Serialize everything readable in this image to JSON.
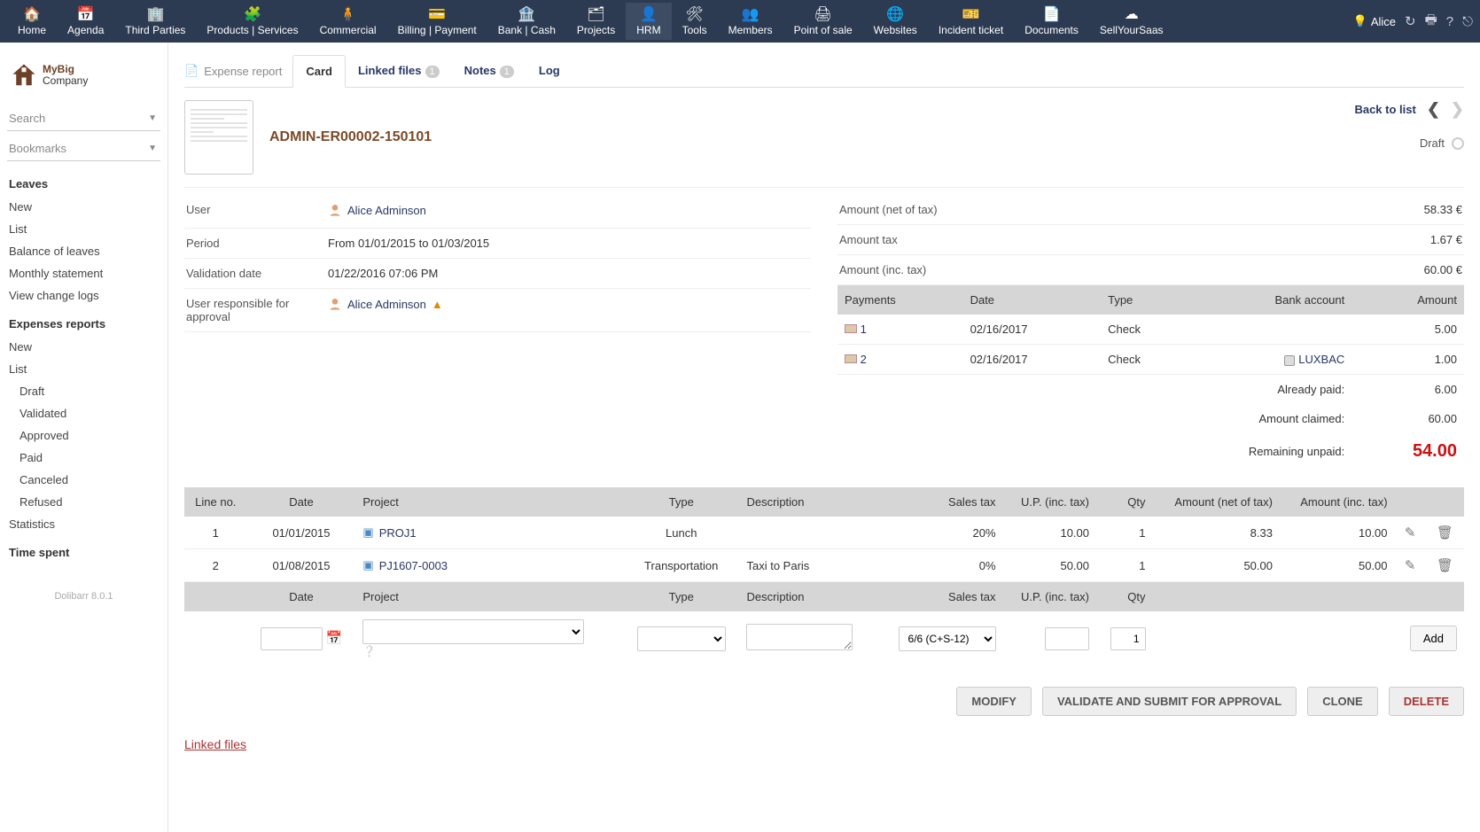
{
  "topnav": {
    "items": [
      {
        "label": "Home",
        "icon": "🏠"
      },
      {
        "label": "Agenda",
        "icon": "📅"
      },
      {
        "label": "Third Parties",
        "icon": "🏢"
      },
      {
        "label": "Products | Services",
        "icon": "🧩"
      },
      {
        "label": "Commercial",
        "icon": "🧍"
      },
      {
        "label": "Billing | Payment",
        "icon": "💳"
      },
      {
        "label": "Bank | Cash",
        "icon": "🏦"
      },
      {
        "label": "Projects",
        "icon": "🗂"
      },
      {
        "label": "HRM",
        "icon": "👤"
      },
      {
        "label": "Tools",
        "icon": "🛠"
      },
      {
        "label": "Members",
        "icon": "👥"
      },
      {
        "label": "Point of sale",
        "icon": "🖨"
      },
      {
        "label": "Websites",
        "icon": "🌐"
      },
      {
        "label": "Incident ticket",
        "icon": "🎫"
      },
      {
        "label": "Documents",
        "icon": "📄"
      },
      {
        "label": "SellYourSaas",
        "icon": "☁"
      }
    ],
    "active_index": 8,
    "user": "Alice"
  },
  "sidebar": {
    "company_line1": "MyBig",
    "company_line2": "Company",
    "search_placeholder": "Search",
    "bookmarks_placeholder": "Bookmarks",
    "sections": [
      {
        "title": "Leaves",
        "items": [
          {
            "label": "New"
          },
          {
            "label": "List"
          },
          {
            "label": "Balance of leaves"
          },
          {
            "label": "Monthly statement"
          },
          {
            "label": "View change logs"
          }
        ]
      },
      {
        "title": "Expenses reports",
        "items": [
          {
            "label": "New"
          },
          {
            "label": "List"
          },
          {
            "label": "Draft",
            "sub": true
          },
          {
            "label": "Validated",
            "sub": true
          },
          {
            "label": "Approved",
            "sub": true
          },
          {
            "label": "Paid",
            "sub": true
          },
          {
            "label": "Canceled",
            "sub": true
          },
          {
            "label": "Refused",
            "sub": true
          },
          {
            "label": "Statistics"
          }
        ]
      },
      {
        "title": "Time spent",
        "items": []
      }
    ],
    "footer": "Dolibarr 8.0.1"
  },
  "tabs": {
    "crumb": "Expense report",
    "items": [
      {
        "label": "Card",
        "badge": null
      },
      {
        "label": "Linked files",
        "badge": "1"
      },
      {
        "label": "Notes",
        "badge": "1"
      },
      {
        "label": "Log",
        "badge": null
      }
    ],
    "active_index": 0
  },
  "card": {
    "ref": "ADMIN-ER00002-150101",
    "back_label": "Back to list",
    "status": "Draft",
    "left": [
      {
        "k": "User",
        "v": "Alice Adminson",
        "user": true
      },
      {
        "k": "Period",
        "v": "From 01/01/2015 to 01/03/2015"
      },
      {
        "k": "Validation date",
        "v": "01/22/2016 07:06 PM"
      },
      {
        "k": "User responsible for approval",
        "v": "Alice Adminson",
        "user": true,
        "warn": true
      }
    ],
    "right": [
      {
        "k": "Amount (net of tax)",
        "v": "58.33 €"
      },
      {
        "k": "Amount tax",
        "v": "1.67 €"
      },
      {
        "k": "Amount (inc. tax)",
        "v": "60.00 €"
      }
    ],
    "payments": {
      "headers": {
        "p": "Payments",
        "d": "Date",
        "t": "Type",
        "b": "Bank account",
        "a": "Amount"
      },
      "rows": [
        {
          "n": "1",
          "d": "02/16/2017",
          "t": "Check",
          "b": "",
          "a": "5.00"
        },
        {
          "n": "2",
          "d": "02/16/2017",
          "t": "Check",
          "b": "LUXBAC",
          "a": "1.00"
        }
      ],
      "totals": [
        {
          "k": "Already paid:",
          "v": "6.00"
        },
        {
          "k": "Amount claimed:",
          "v": "60.00"
        },
        {
          "k": "Remaining unpaid:",
          "v": "54.00",
          "big": true
        }
      ]
    }
  },
  "lines": {
    "headers": {
      "n": "Line no.",
      "d": "Date",
      "p": "Project",
      "t": "Type",
      "desc": "Description",
      "tax": "Sales tax",
      "up": "U.P. (inc. tax)",
      "q": "Qty",
      "net": "Amount (net of tax)",
      "inc": "Amount (inc. tax)"
    },
    "rows": [
      {
        "n": "1",
        "d": "01/01/2015",
        "p": "PROJ1",
        "t": "Lunch",
        "desc": "",
        "tax": "20%",
        "up": "10.00",
        "q": "1",
        "net": "8.33",
        "inc": "10.00"
      },
      {
        "n": "2",
        "d": "01/08/2015",
        "p": "PJ1607-0003",
        "t": "Transportation",
        "desc": "Taxi to Paris",
        "tax": "0%",
        "up": "50.00",
        "q": "1",
        "net": "50.00",
        "inc": "50.00"
      }
    ],
    "newrow": {
      "tax_selected": "6/6 (C+S-12)",
      "qty": "1",
      "add": "Add"
    }
  },
  "actions": {
    "modify": "MODIFY",
    "validate": "VALIDATE AND SUBMIT FOR APPROVAL",
    "clone": "CLONE",
    "delete": "DELETE"
  },
  "linkedfiles_title": "Linked files"
}
